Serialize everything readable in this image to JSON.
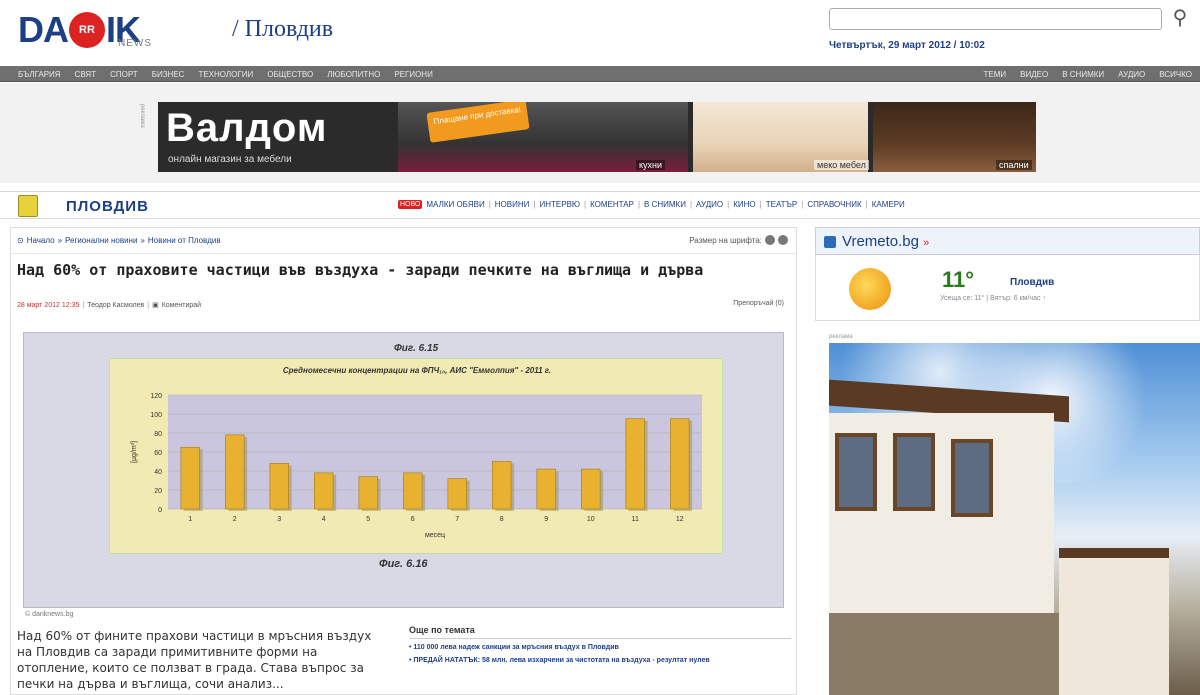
{
  "header": {
    "logo_da": "DA",
    "logo_ik": "IK",
    "logo_news": "NEWS",
    "city": "/ Пловдив",
    "search_placeholder": "",
    "search_icon": "search-icon",
    "datetime": "Четвъртък, 29 март 2012 / 10:02"
  },
  "nav": {
    "left": [
      "БЪЛГАРИЯ",
      "СВЯТ",
      "СПОРТ",
      "БИЗНЕС",
      "ТЕХНОЛОГИИ",
      "ОБЩЕСТВО",
      "ЛЮБОПИТНО",
      "РЕГИОНИ"
    ],
    "right": [
      "ТЕМИ",
      "ВИДЕО",
      "В СНИМКИ",
      "АУДИО",
      "ВСИЧКО"
    ]
  },
  "banner": {
    "label": "реклама",
    "logo": "Валдом",
    "tagline": "онлайн магазин за мебели",
    "badge": "Плащане при доставка!",
    "cap1": "кухни",
    "cap2": "меко мебел",
    "cap3": "спални"
  },
  "section": {
    "title": "ПЛОВДИВ",
    "new_badge": "НОВО",
    "menu": [
      "МАЛКИ ОБЯВИ",
      "НОВИНИ",
      "ИНТЕРВЮ",
      "КОМЕНТАР",
      "В СНИМКИ",
      "АУДИО",
      "КИНО",
      "ТЕАТЪР",
      "СПРАВОЧНИК",
      "КАМЕРИ"
    ]
  },
  "article": {
    "breadcrumb": [
      "Начало",
      "Регионални новини",
      "Новини от Пловдив"
    ],
    "font_size_label": "Размер на шрифта:",
    "headline": "Над 60% от праховите частици във въздуха - заради печките на въглища и дърва",
    "date": "28 март 2012 12:35",
    "author": "Теодор Касмолев",
    "comments": "Коментирай",
    "share": "Препоръчай (0)",
    "figure_title_a": "Фиг. 6.15",
    "figure_title_b": "Фиг. 6.16",
    "photo_credit": "© dariknews.bg",
    "body": "Над 60% от фините прахови частици в мръсния въздух на Пловдив са заради примитивните форми на отопление, които се ползват в града. Става въпрос за печки на дърва и въглища, сочи анализ...",
    "related_title": "Още по темата",
    "related": [
      "• 110 000 лева надеж санкции за мръсния въздух в Пловдив",
      "• ПРЕДАЙ НАТАТЪК: 58 млн. лева изхарчени за чистотата на въздуха - резултат нулев"
    ]
  },
  "weather": {
    "brand": "Vremeto.bg",
    "arrow": "»",
    "temp": "11°",
    "city": "Пловдив",
    "details": "Усеща се: 11° | Вятър: 6 км/час  ↑",
    "ad_label": "реклама"
  },
  "chart_data": {
    "type": "bar",
    "title": "Средномесечни концентрации на ФПЧ₁₀, АИС \"Еммолпия\" - 2011 г.",
    "xlabel": "месец",
    "ylabel": "[µg/m³]",
    "ylim": [
      0,
      120
    ],
    "yticks": [
      0,
      20,
      40,
      60,
      80,
      100,
      120
    ],
    "categories": [
      "1",
      "2",
      "3",
      "4",
      "5",
      "6",
      "7",
      "8",
      "9",
      "10",
      "11",
      "12"
    ],
    "values": [
      65,
      78,
      48,
      38,
      34,
      38,
      32,
      50,
      42,
      42,
      95,
      95
    ],
    "bar_color": "#e8b130",
    "plot_bg": "#c9c6dd",
    "grid": true
  }
}
